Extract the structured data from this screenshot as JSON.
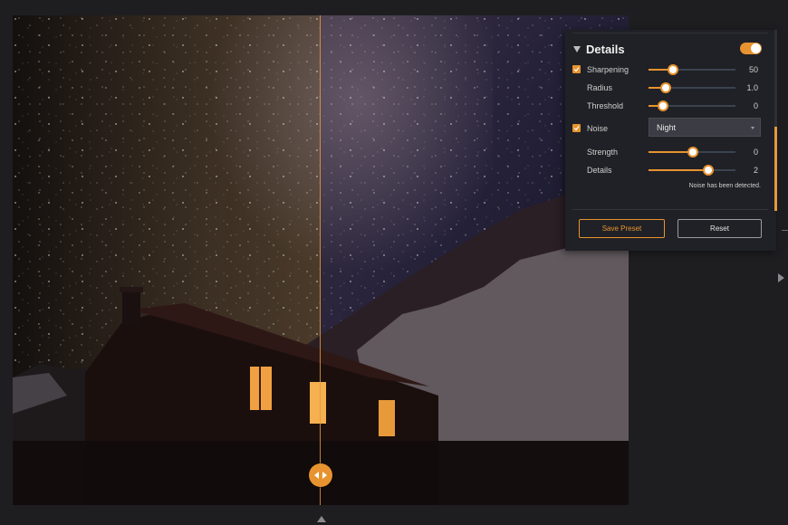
{
  "photo": {
    "alt_name": "night sky cabin photo",
    "before_after_split": true
  },
  "panel": {
    "title": "Details",
    "enabled": true,
    "sharpening": {
      "label": "Sharpening",
      "checked": true,
      "value": "50",
      "level": 0.27,
      "radius": {
        "label": "Radius",
        "value": "1.0",
        "level": 0.19
      },
      "threshold": {
        "label": "Threshold",
        "value": "0",
        "level": 0.16
      }
    },
    "noise": {
      "label": "Noise",
      "checked": true,
      "preset": "Night",
      "strength": {
        "label": "Strength",
        "value": "0",
        "level": 0.5
      },
      "details": {
        "label": "Details",
        "value": "2",
        "level": 0.68
      },
      "message": "Noise has been detected."
    },
    "buttons": {
      "save_preset": "Save Preset",
      "reset": "Reset"
    }
  },
  "colors": {
    "accent": "#e7932f",
    "panel_bg": "#202126",
    "app_bg": "#1e1e21"
  }
}
